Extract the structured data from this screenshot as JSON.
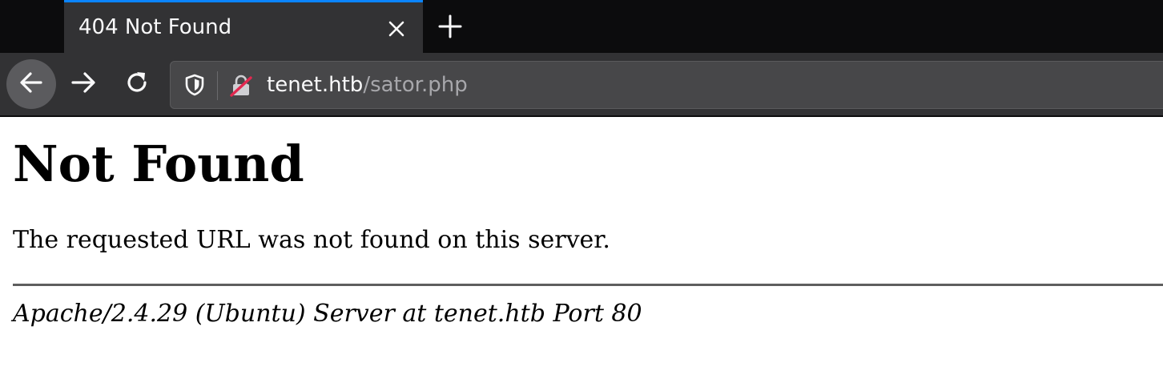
{
  "browser": {
    "tab": {
      "title": "404 Not Found",
      "close_icon": "close-icon",
      "accent": "#0a84ff"
    },
    "new_tab_icon": "plus-icon",
    "nav": {
      "back_icon": "arrow-left-icon",
      "forward_icon": "arrow-right-icon",
      "reload_icon": "reload-icon"
    },
    "urlbar": {
      "tracking_icon": "shield-icon",
      "security_icon": "insecure-lock-icon",
      "host": "tenet.htb",
      "path": "/sator.php"
    }
  },
  "page": {
    "heading": "Not Found",
    "message": "The requested URL was not found on this server.",
    "server_signature": "Apache/2.4.29 (Ubuntu) Server at tenet.htb Port 80"
  }
}
